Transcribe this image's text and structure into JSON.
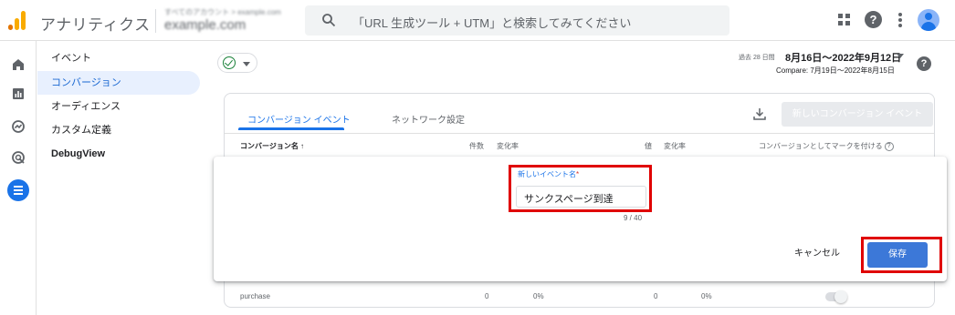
{
  "header": {
    "app_title": "アナリティクス",
    "account_name": "すべてのアカウント > example.com",
    "property_name": "example.com",
    "search_placeholder": "「URL 生成ツール + UTM」と検索してみてください"
  },
  "subnav": {
    "items": [
      {
        "label": "イベント"
      },
      {
        "label": "コンバージョン"
      },
      {
        "label": "オーディエンス"
      },
      {
        "label": "カスタム定義"
      },
      {
        "label": "DebugView"
      }
    ]
  },
  "date_range": {
    "label": "過去 28 日間",
    "value": "8月16日～2022年9月12日",
    "compare": "Compare: 7月19日～2022年8月15日"
  },
  "card": {
    "tabs": [
      {
        "label": "コンバージョン イベント"
      },
      {
        "label": "ネットワーク設定"
      }
    ],
    "new_button_label": "新しいコンバージョン イベント",
    "columns": {
      "name": "コンバージョン名 ↑",
      "count": "件数",
      "count_change": "変化率",
      "value": "値",
      "value_change": "変化率",
      "mark": "コンバージョンとしてマークを付ける"
    },
    "row": {
      "name": "purchase",
      "count": "0",
      "count_change": "0%",
      "value": "0",
      "value_change": "0%"
    }
  },
  "dialog": {
    "field_label": "新しいイベント名",
    "required_mark": "*",
    "field_value": "サンクスページ到達",
    "counter": "9 / 40",
    "cancel_label": "キャンセル",
    "save_label": "保存"
  },
  "colors": {
    "accent": "#1a73e8",
    "highlight_box": "#e00000",
    "save_button": "#3c78d8",
    "nav_active_bg": "#e8f0fe"
  },
  "icons": {
    "header": [
      "analytics-logo",
      "search-icon",
      "apps-grid-icon",
      "help-icon",
      "more-vert-icon",
      "account-avatar"
    ],
    "rail": [
      "home-icon",
      "reports-icon",
      "explore-icon",
      "advertising-icon",
      "configure-icon"
    ]
  }
}
